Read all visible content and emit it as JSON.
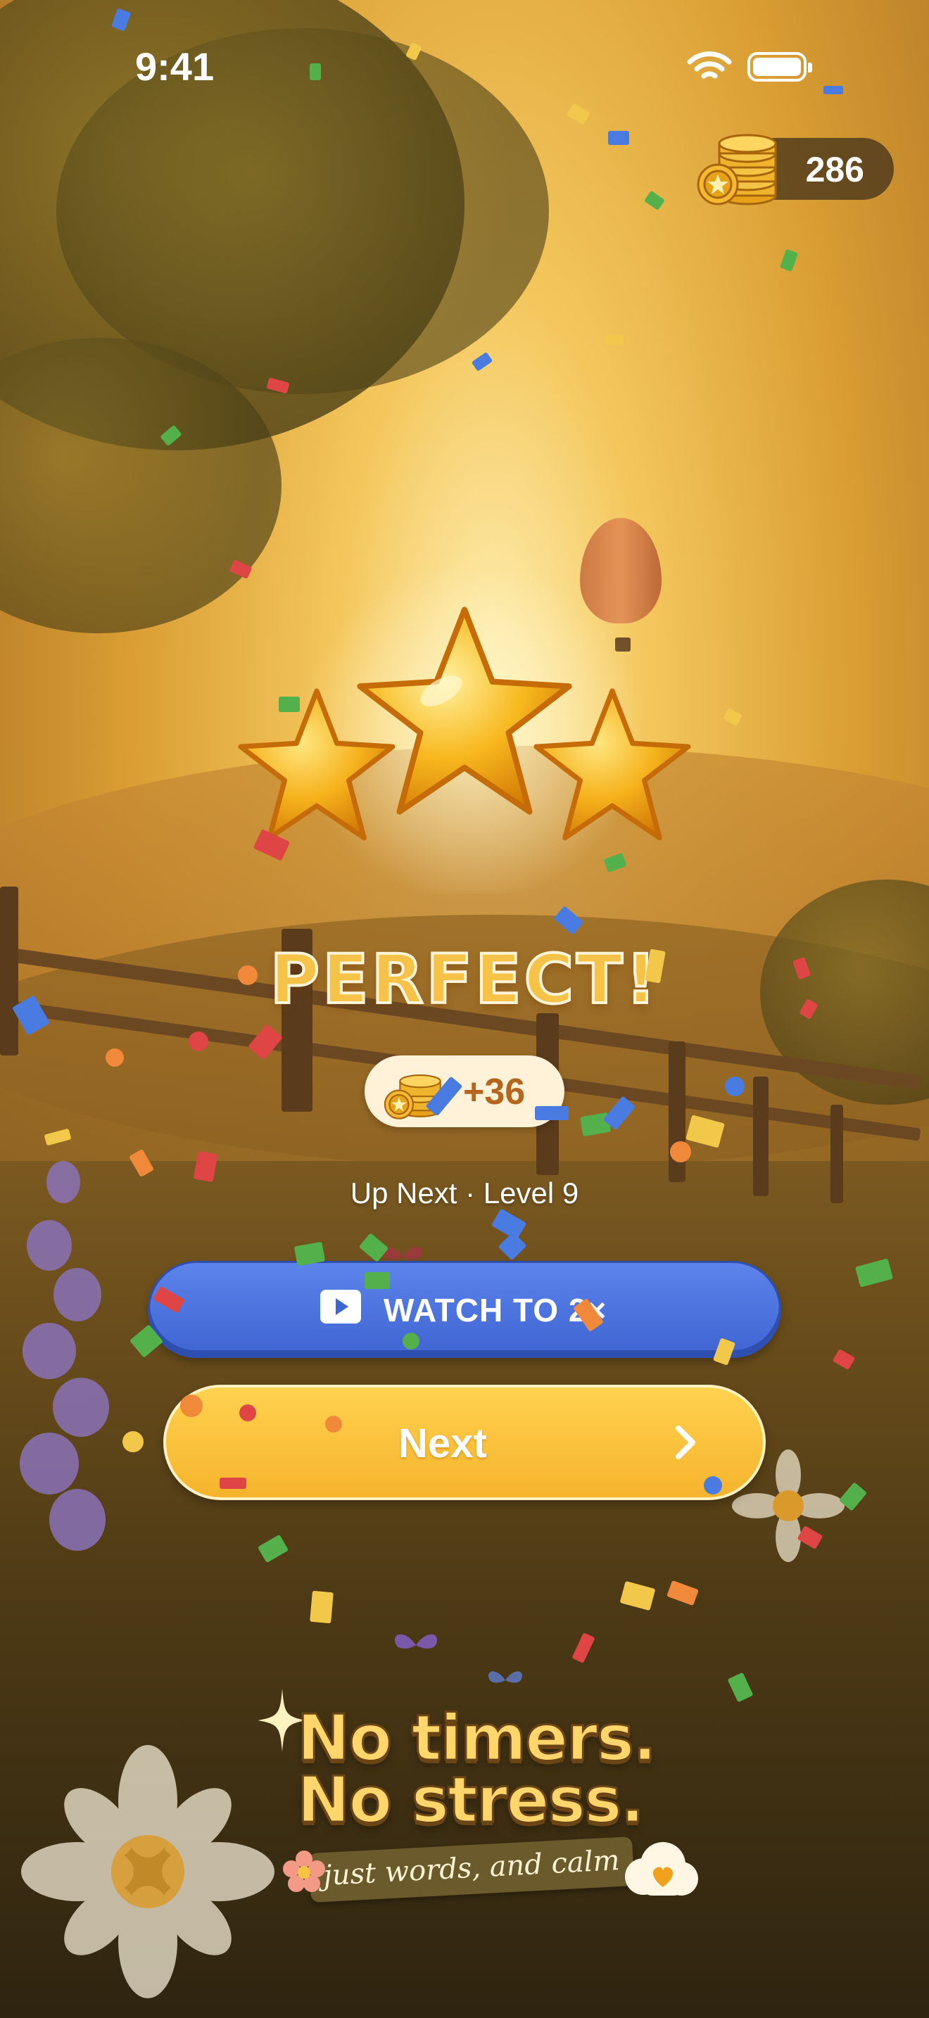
{
  "status_bar": {
    "time": "9:41",
    "wifi_icon": "wifi-icon",
    "battery_icon": "battery-icon"
  },
  "currency": {
    "coins": "286",
    "icon": "coin-stack-icon"
  },
  "result": {
    "stars_earned": 3,
    "stars_total": 3,
    "title": "PERFECT!",
    "reward": "+36",
    "reward_icon": "coin-stack-icon"
  },
  "up_next": "Up Next · Level 9",
  "buttons": {
    "watch": {
      "label": "WATCH TO 2×",
      "icon": "play-icon",
      "color": "#4a6fdc"
    },
    "next": {
      "label": "Next",
      "icon": "chevron-right-icon",
      "color": "#fbc23d"
    }
  },
  "tagline": {
    "line1": "No timers.",
    "line2": "No stress.",
    "sub": "just words, and calm"
  },
  "colors": {
    "accent_gold": "#f6c247",
    "button_blue": "#4a6fdc",
    "button_yellow": "#fbc23d",
    "reward_text": "#b6651c"
  }
}
